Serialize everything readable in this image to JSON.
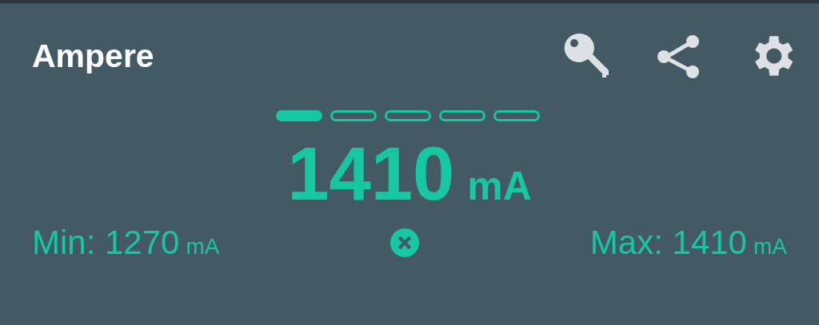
{
  "app_bar": {
    "title": "Ampere"
  },
  "pages": [
    {
      "selected": true
    },
    {
      "selected": false
    },
    {
      "selected": false
    },
    {
      "selected": false
    },
    {
      "selected": false
    }
  ],
  "reading": {
    "value": "1410",
    "unit": "mA"
  },
  "min": {
    "label": "Min: 1270",
    "unit": "mA"
  },
  "max": {
    "label": "Max: 1410",
    "unit": "mA"
  }
}
